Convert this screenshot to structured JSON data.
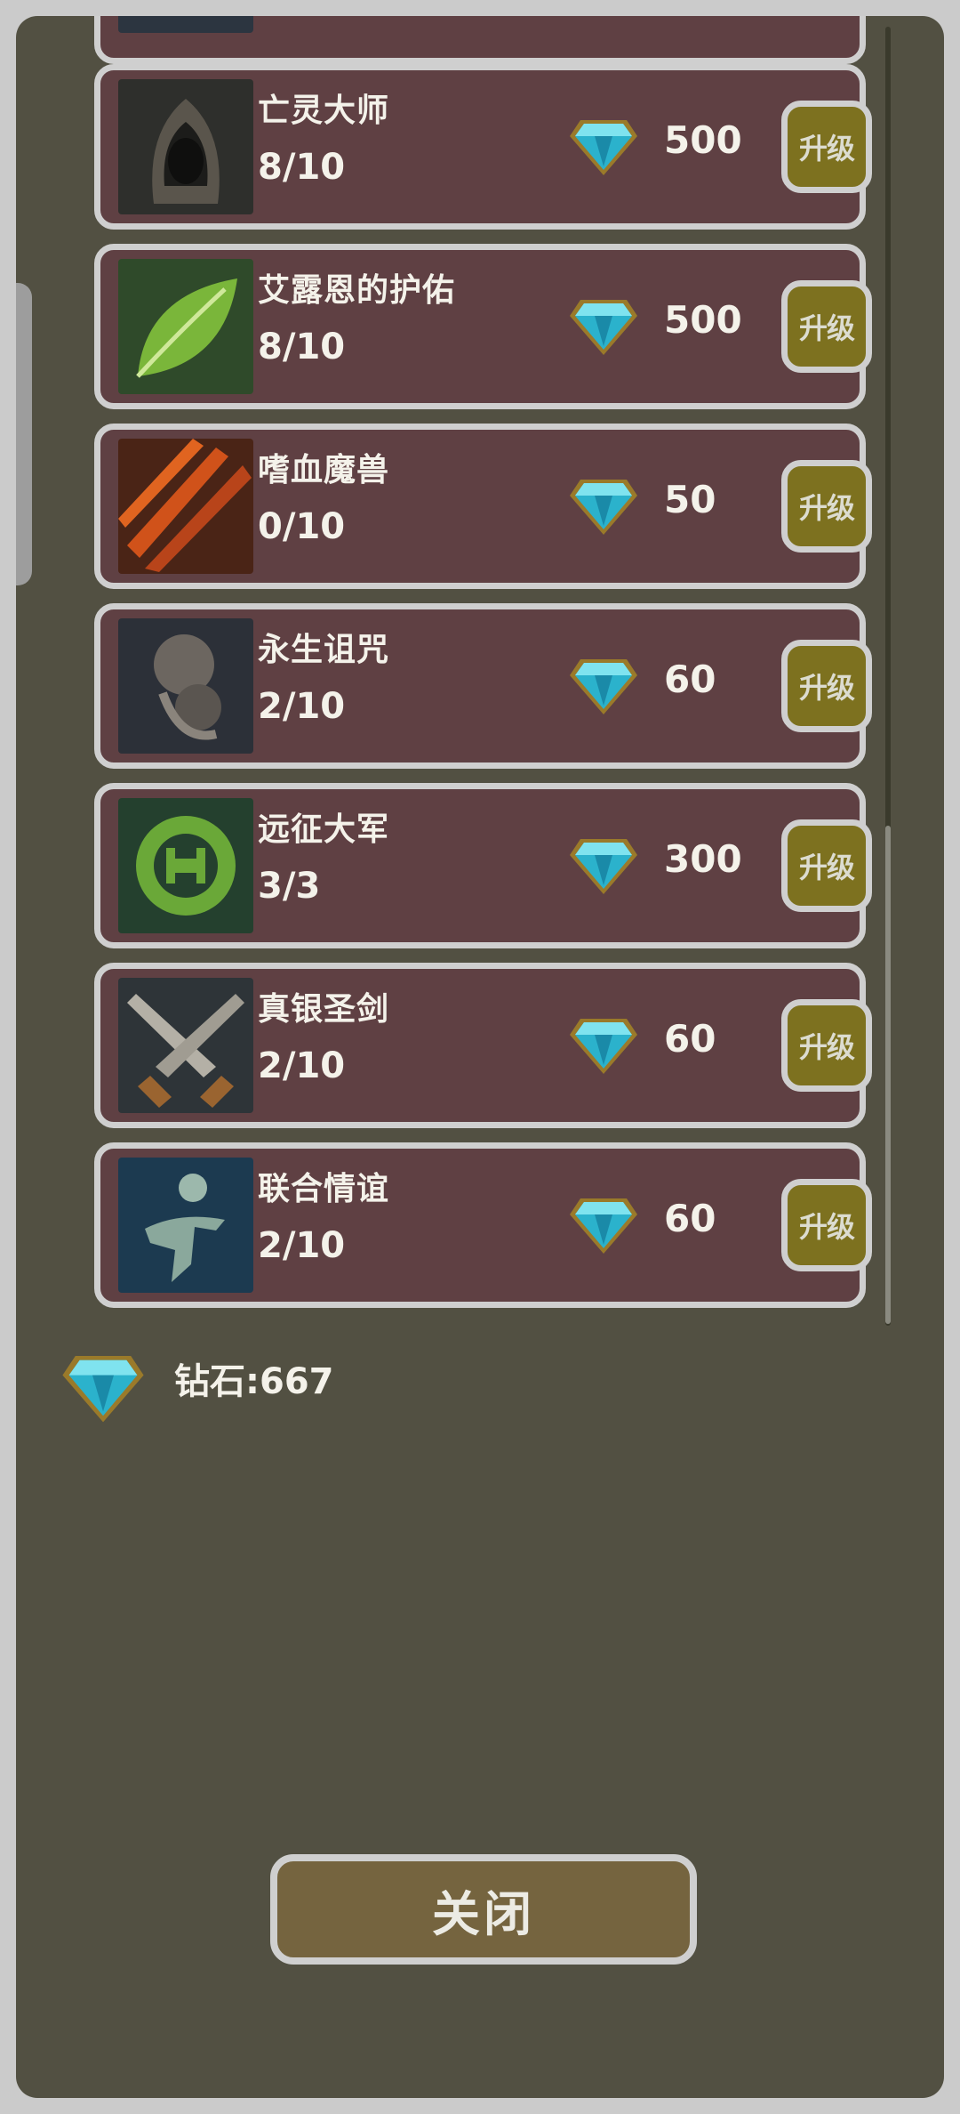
{
  "skills": [
    {
      "name": "亡灵大师",
      "level": "8/10",
      "cost": "500",
      "upgrade_label": "升级",
      "icon": "hooded-figure-icon"
    },
    {
      "name": "艾露恩的护佑",
      "level": "8/10",
      "cost": "500",
      "upgrade_label": "升级",
      "icon": "leaf-icon"
    },
    {
      "name": "嗜血魔兽",
      "level": "0/10",
      "cost": "50",
      "upgrade_label": "升级",
      "icon": "claw-slash-icon"
    },
    {
      "name": "永生诅咒",
      "level": "2/10",
      "cost": "60",
      "upgrade_label": "升级",
      "icon": "smoke-curse-icon"
    },
    {
      "name": "远征大军",
      "level": "3/3",
      "cost": "300",
      "upgrade_label": "升级",
      "icon": "green-emblem-icon"
    },
    {
      "name": "真银圣剑",
      "level": "2/10",
      "cost": "60",
      "upgrade_label": "升级",
      "icon": "crossed-swords-icon"
    },
    {
      "name": "联合情谊",
      "level": "2/10",
      "cost": "60",
      "upgrade_label": "升级",
      "icon": "spirit-figure-icon"
    }
  ],
  "balance": {
    "label": "钻石:667",
    "icon": "diamond-icon"
  },
  "close_label": "关闭",
  "colors": {
    "panel": "#525042",
    "row": "#5f4043",
    "upgrade": "#7d711f",
    "close": "#75643f",
    "border": "#cfcfcf"
  }
}
